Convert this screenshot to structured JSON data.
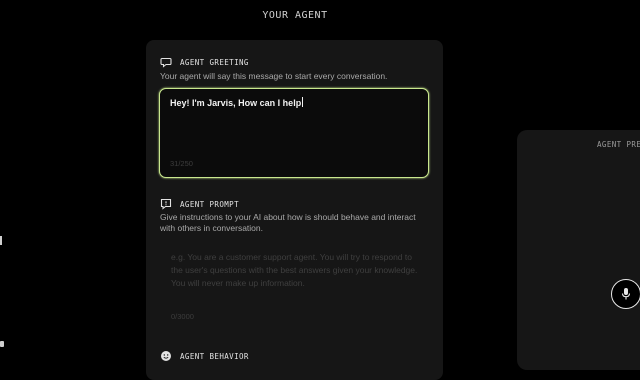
{
  "header": {
    "title": "YOUR AGENT"
  },
  "greeting": {
    "heading": "AGENT GREETING",
    "description": "Your agent will say this message to start every conversation.",
    "value": "Hey! I'm Jarvis, How can I help",
    "counter": "31/250"
  },
  "prompt": {
    "heading": "AGENT PROMPT",
    "description": "Give instructions to your AI about how is should behave and interact with others in conversation.",
    "placeholder": "e.g. You are a customer support agent. You will try to respond to the user's questions with the best answers given your knowledge. You will never make up information.",
    "counter": "0/3000"
  },
  "behavior": {
    "heading": "AGENT BEHAVIOR"
  },
  "preview": {
    "title": "AGENT PREVIEW"
  },
  "colors": {
    "accent_border": "#c9e88e",
    "background": "#000000",
    "card": "#161616"
  },
  "icons": {
    "greeting": "chat-bubble-icon",
    "prompt": "message-square-icon",
    "behavior": "smiley-face-icon",
    "mic": "microphone-icon"
  }
}
